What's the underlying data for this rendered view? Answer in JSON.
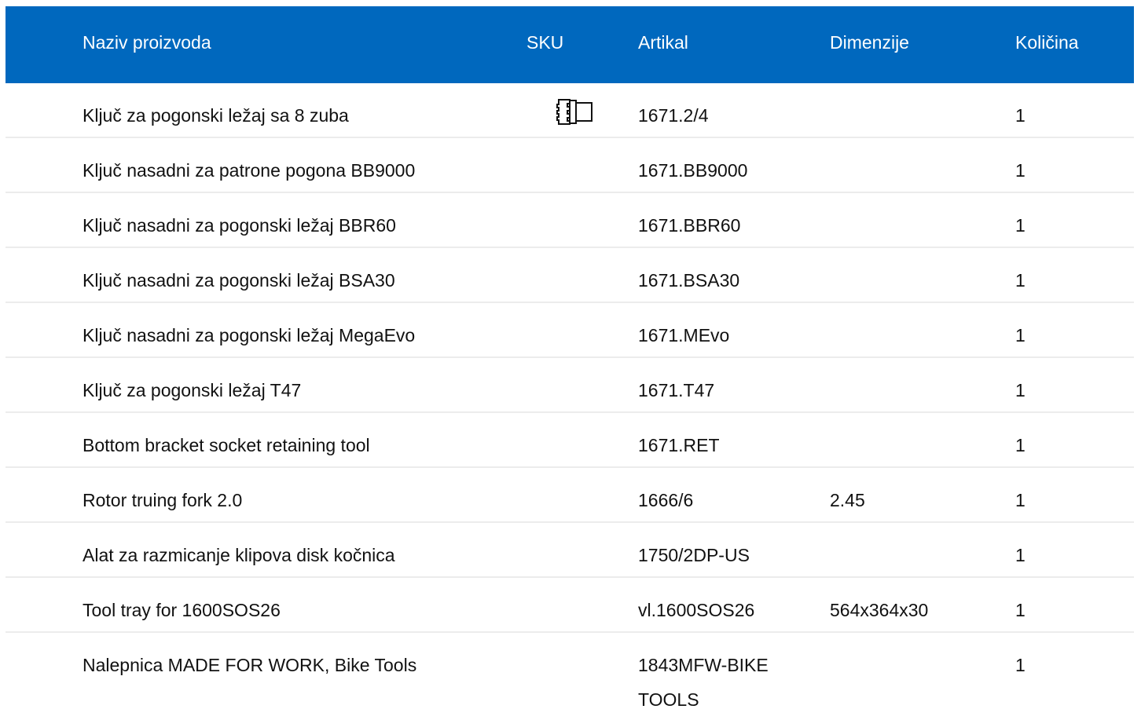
{
  "columns": {
    "name": "Naziv proizvoda",
    "sku": "SKU",
    "article": "Artikal",
    "dimensions": "Dimenzije",
    "quantity": "Količina"
  },
  "rows": [
    {
      "name": "Ključ za pogonski ležaj sa 8 zuba",
      "sku_icon": "socket-tool-icon",
      "article": "1671.2/4",
      "dimensions": "",
      "quantity": "1"
    },
    {
      "name": "Ključ nasadni za patrone pogona BB9000",
      "article": "1671.BB9000",
      "dimensions": "",
      "quantity": "1"
    },
    {
      "name": "Ključ nasadni za pogonski ležaj BBR60",
      "article": "1671.BBR60",
      "dimensions": "",
      "quantity": "1"
    },
    {
      "name": "Ključ nasadni za pogonski ležaj BSA30",
      "article": "1671.BSA30",
      "dimensions": "",
      "quantity": "1"
    },
    {
      "name": "Ključ nasadni za pogonski ležaj MegaEvo",
      "article": "1671.MEvo",
      "dimensions": "",
      "quantity": "1"
    },
    {
      "name": "Ključ za pogonski ležaj T47",
      "article": "1671.T47",
      "dimensions": "",
      "quantity": "1"
    },
    {
      "name": "Bottom bracket socket retaining tool",
      "article": "1671.RET",
      "dimensions": "",
      "quantity": "1"
    },
    {
      "name": "Rotor truing fork 2.0",
      "article": "1666/6",
      "dimensions": "2.45",
      "quantity": "1"
    },
    {
      "name": "Alat za razmicanje klipova disk kočnica",
      "article": "1750/2DP-US",
      "dimensions": "",
      "quantity": "1"
    },
    {
      "name": "Tool tray for 1600SOS26",
      "article": "vl.1600SOS26",
      "dimensions": "564x364x30",
      "quantity": "1"
    },
    {
      "name": "Nalepnica MADE FOR WORK, Bike Tools",
      "article": "1843MFW-BIKE TOOLS",
      "dimensions": "",
      "quantity": "1"
    }
  ],
  "colors": {
    "header_bg": "#0068be",
    "header_text": "#ffffff",
    "row_divider": "#ececec"
  }
}
